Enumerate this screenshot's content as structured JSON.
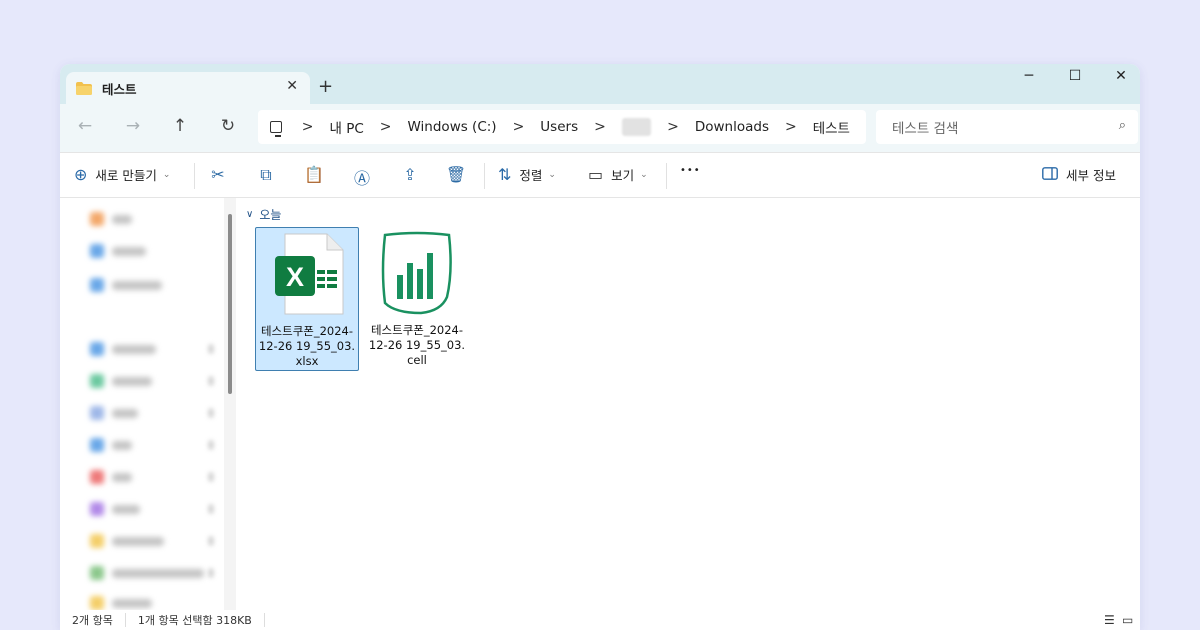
{
  "tab": {
    "title": "테스트",
    "close": "✕",
    "new_tab": "+"
  },
  "window_controls": {
    "minimize": "─",
    "maximize": "☐",
    "close": "✕"
  },
  "nav": {
    "back": "←",
    "forward": "→",
    "up": "↑",
    "refresh": "↻"
  },
  "breadcrumb": {
    "separator": ">",
    "items": [
      "내 PC",
      "Windows (C:)",
      "Users",
      "Downloads",
      "테스트"
    ]
  },
  "search": {
    "placeholder": "테스트 검색",
    "icon": "⌕"
  },
  "toolbar": {
    "new_label": "새로 만들기",
    "sort_label": "정렬",
    "view_label": "보기",
    "more_label": "•••",
    "details_label": "세부 정보",
    "chevron": "⌄",
    "icons": {
      "new": "⊕",
      "cut": "✂",
      "copy": "⧉",
      "paste": "📋",
      "rename": "Ⓐ",
      "share": "⇪",
      "delete": "🗑",
      "sort": "⇅",
      "view": "▭"
    }
  },
  "content": {
    "group_label": "오늘",
    "files": [
      {
        "name": "테스트쿠폰_2024-12-26 19_55_03.xlsx",
        "icon": "excel-icon",
        "selected": true
      },
      {
        "name": "테스트쿠폰_2024-12-26 19_55_03.cell",
        "icon": "cell-chart-icon",
        "selected": false
      }
    ]
  },
  "statusbar": {
    "item_count": "2개 항목",
    "selection": "1개 항목 선택함 318KB"
  },
  "colors": {
    "background": "#e6e8fb",
    "titlebar": "#d7ebf0",
    "selection": "#cce8ff",
    "excel_green": "#107c41",
    "cell_green": "#1a9160"
  }
}
